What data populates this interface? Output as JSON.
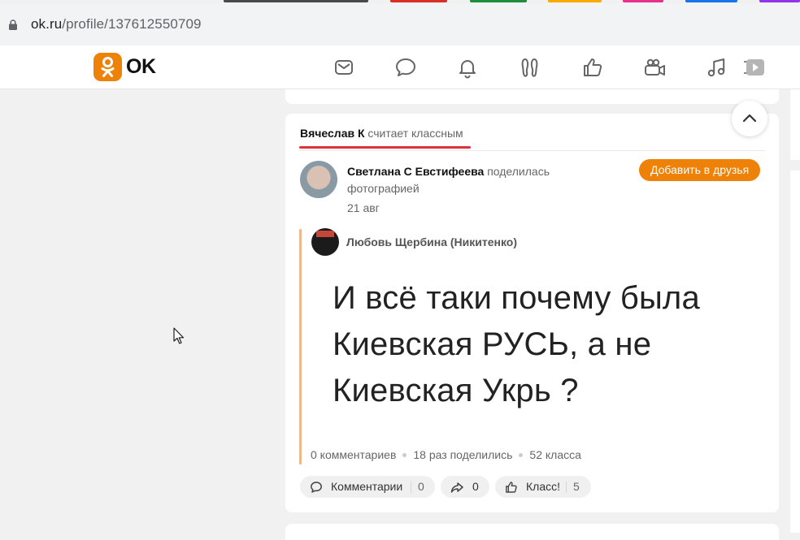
{
  "tab_colors": [
    "#4a4a4a",
    "#d93025",
    "#1e8e3e",
    "#f9ab00",
    "#e8318f",
    "#1a73e8",
    "#9334e6"
  ],
  "browser": {
    "url_domain": "ok.ru",
    "url_path": "/profile/137612550709"
  },
  "header": {
    "logo_text": "OK",
    "nav_icons": [
      "mail-icon",
      "chat-icon",
      "bell-icon",
      "guests-icon",
      "like-icon",
      "video-icon",
      "music-icon",
      "video-play-icon"
    ]
  },
  "post": {
    "liker_name": "Вячеслав К",
    "liker_suffix": " считает классным",
    "author": "Светлана С Евстифеева",
    "author_action": " поделилась фотографией",
    "date": "21 авг",
    "add_friend_label": "Добавить в друзья",
    "repost_author": "Любовь Щербина (Никитенко)",
    "image_text_line1": "И всё таки почему была",
    "image_text_line2": "Киевская РУСЬ, а не",
    "image_text_line3": "Киевская Укрь ?",
    "stats": {
      "comments": "0 комментариев",
      "shares": "18 раз поделились",
      "likes": "52 класса"
    },
    "actions": {
      "comments_label": "Комментарии",
      "comments_count": "0",
      "share_count": "0",
      "like_label": "Класс!",
      "like_count": "5"
    }
  },
  "colors": {
    "accent": "#ee8208",
    "liker_underline": "#e0303a"
  }
}
